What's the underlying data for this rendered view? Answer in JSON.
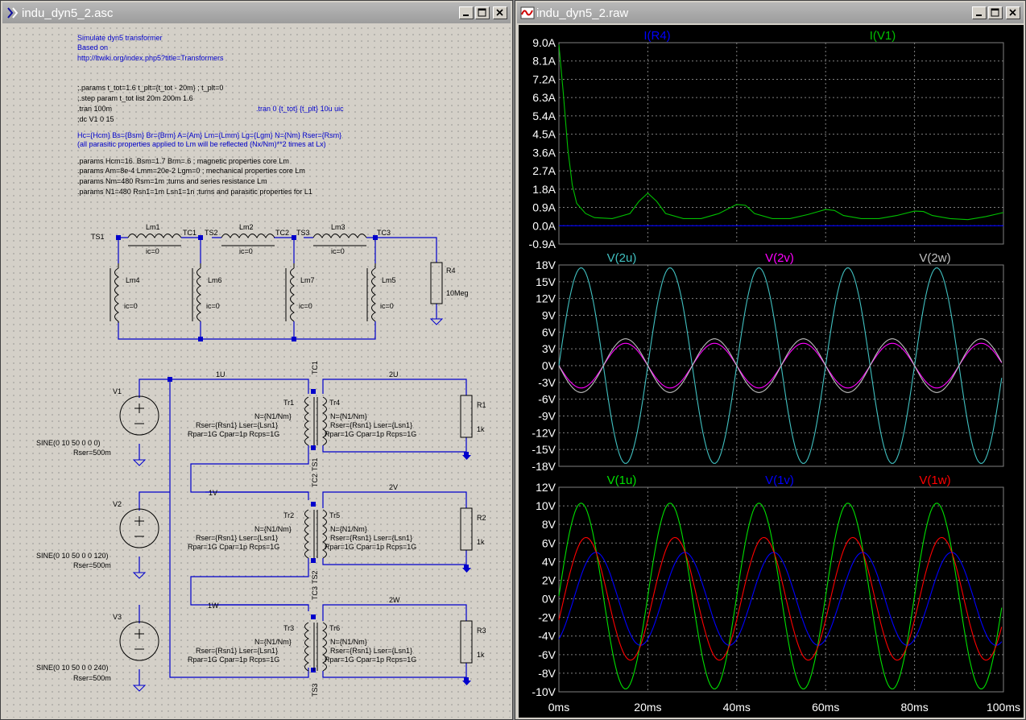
{
  "schematic": {
    "title": "indu_dyn5_2.asc",
    "comments": [
      "Simulate dyn5 transformer",
      "Based on",
      "http://ltwiki.org/index.php5?title=Transformers"
    ],
    "directives": [
      ";.params t_tot=1.6 t_plt={t_tot - 20m} ; t_plt=0",
      ";.step param t_tot list 20m 200m 1.6",
      ".tran 100m",
      ";dc V1 0 15"
    ],
    "tran_alt": ".tran 0 {t_tot} {t_plt} 10u uic",
    "model_lines": [
      "Hc={Hcm} Bs={Bsm} Br={Brm} A={Am} Lm={Lmm} Lg={Lgm} N={Nm} Rser={Rsm}",
      "(all parasitic properties applied to Lm will be reflected (Nx/Nm)**2 times at Lx)"
    ],
    "params": [
      ".params Hcm=16. Bsm=1.7 Brm=.6 ; magnetic properties core Lm",
      ".params Am=8e-4 Lmm=20e-2 Lgm=0 ; mechanical properties core Lm",
      ".params Nm=480 Rsm=1m ;turns and series resistance Lm",
      ".params N1=480 Rsn1=1m Lsn1=1n ;turns and parasitic properties for L1"
    ],
    "nets": {
      "ts1": "TS1",
      "tc1": "TC1",
      "ts2": "TS2",
      "tc2": "TC2",
      "ts3": "TS3",
      "tc3": "TC3",
      "n1u": "1U",
      "n2u": "2U",
      "n1v": "1V",
      "n2v": "2V",
      "n1w": "1W",
      "n2w": "2W"
    },
    "inductors": [
      {
        "name": "Lm1",
        "ic": "ic=0"
      },
      {
        "name": "Lm2",
        "ic": "ic=0"
      },
      {
        "name": "Lm3",
        "ic": "ic=0"
      },
      {
        "name": "Lm4",
        "ic": "ic=0"
      },
      {
        "name": "Lm6",
        "ic": "ic=0"
      },
      {
        "name": "Lm7",
        "ic": "ic=0"
      },
      {
        "name": "Lm5",
        "ic": "ic=0"
      }
    ],
    "r4": {
      "name": "R4",
      "value": "10Meg"
    },
    "sources": [
      {
        "name": "V1",
        "value": "SINE(0 10 50 0 0 0)",
        "rser": "Rser=500m"
      },
      {
        "name": "V2",
        "value": "SINE(0 10 50 0 0 120)",
        "rser": "Rser=500m"
      },
      {
        "name": "V3",
        "value": "SINE(0 10 50 0 0 240)",
        "rser": "Rser=500m"
      }
    ],
    "transformers": [
      {
        "prim": "Tr1",
        "sec": "Tr4",
        "r": "R1",
        "rval": "1k"
      },
      {
        "prim": "Tr2",
        "sec": "Tr5",
        "r": "R2",
        "rval": "1k"
      },
      {
        "prim": "Tr3",
        "sec": "Tr6",
        "r": "R3",
        "rval": "1k"
      }
    ],
    "tr_lines": [
      "N={N1/Nm}",
      "Rser={Rsn1} Lser={Lsn1}",
      "Rpar=1G Cpar=1p Rcps=1G"
    ]
  },
  "waveform": {
    "title": "indu_dyn5_2.raw",
    "colors": {
      "bg": "#000000",
      "grid": "#808080",
      "green": "#00c000",
      "blue": "#0000ff",
      "cyan": "#40c0c0",
      "magenta": "#ff00ff",
      "gray": "#c0c0c0",
      "red": "#ff0000"
    },
    "x_ticks": [
      "0ms",
      "20ms",
      "40ms",
      "60ms",
      "80ms",
      "100ms"
    ]
  },
  "chart_data": [
    {
      "type": "line",
      "x_range": [
        0,
        100
      ],
      "x_unit": "ms",
      "ylim": [
        -0.9,
        9.0
      ],
      "y_ticks": [
        "9.0A",
        "8.1A",
        "7.2A",
        "6.3A",
        "5.4A",
        "4.5A",
        "3.6A",
        "2.7A",
        "1.8A",
        "0.9A",
        "0.0A",
        "-0.9A"
      ],
      "series": [
        {
          "name": "I(R4)",
          "color": "#0000ff",
          "points": [
            [
              0,
              0
            ],
            [
              100,
              0
            ]
          ]
        },
        {
          "name": "I(V1)",
          "color": "#00c000",
          "points": [
            [
              0,
              8.9
            ],
            [
              1,
              6.5
            ],
            [
              2,
              3.8
            ],
            [
              3,
              2.0
            ],
            [
              4,
              1.1
            ],
            [
              6,
              0.6
            ],
            [
              8,
              0.4
            ],
            [
              12,
              0.35
            ],
            [
              16,
              0.6
            ],
            [
              18,
              1.2
            ],
            [
              20,
              1.6
            ],
            [
              22,
              1.2
            ],
            [
              24,
              0.6
            ],
            [
              28,
              0.35
            ],
            [
              32,
              0.35
            ],
            [
              36,
              0.6
            ],
            [
              40,
              1.05
            ],
            [
              42,
              1.0
            ],
            [
              44,
              0.6
            ],
            [
              48,
              0.35
            ],
            [
              52,
              0.35
            ],
            [
              56,
              0.55
            ],
            [
              60,
              0.8
            ],
            [
              62,
              0.75
            ],
            [
              64,
              0.5
            ],
            [
              68,
              0.35
            ],
            [
              72,
              0.35
            ],
            [
              76,
              0.5
            ],
            [
              80,
              0.72
            ],
            [
              82,
              0.7
            ],
            [
              84,
              0.5
            ],
            [
              88,
              0.35
            ],
            [
              92,
              0.3
            ],
            [
              96,
              0.45
            ],
            [
              100,
              0.65
            ]
          ]
        }
      ]
    },
    {
      "type": "line",
      "x_range": [
        0,
        100
      ],
      "x_unit": "ms",
      "ylim": [
        -18,
        18
      ],
      "y_ticks": [
        "18V",
        "15V",
        "12V",
        "9V",
        "6V",
        "3V",
        "0V",
        "-3V",
        "-6V",
        "-9V",
        "-12V",
        "-15V",
        "-18V"
      ],
      "series": [
        {
          "name": "V(2u)",
          "color": "#40c0c0",
          "amp": 17.5,
          "phase_deg": 0
        },
        {
          "name": "V(2v)",
          "color": "#ff00ff",
          "amp": 4.0,
          "phase_deg": 180
        },
        {
          "name": "V(2w)",
          "color": "#c0c0c0",
          "amp": 4.8,
          "phase_deg": 180
        }
      ]
    },
    {
      "type": "line",
      "x_range": [
        0,
        100
      ],
      "x_unit": "ms",
      "ylim": [
        -10,
        12
      ],
      "y_ticks": [
        "12V",
        "10V",
        "8V",
        "6V",
        "4V",
        "2V",
        "0V",
        "-2V",
        "-4V",
        "-6V",
        "-8V",
        "-10V"
      ],
      "series": [
        {
          "name": "V(1u)",
          "color": "#00e000",
          "amp": 10.0,
          "phase_deg": 0,
          "offset": 0.3
        },
        {
          "name": "V(1v)",
          "color": "#0000ff",
          "amp": 5.0,
          "phase_deg": -60,
          "offset": 0
        },
        {
          "name": "V(1w)",
          "color": "#ff0000",
          "amp": 6.6,
          "phase_deg": -20,
          "offset": 0
        }
      ]
    }
  ]
}
